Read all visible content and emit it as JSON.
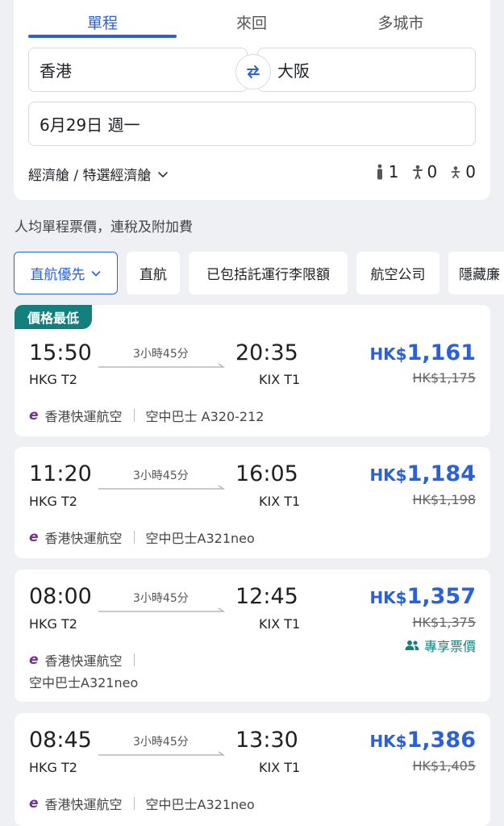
{
  "tabs": [
    {
      "label": "單程",
      "active": true
    },
    {
      "label": "來回",
      "active": false
    },
    {
      "label": "多城市",
      "active": false
    }
  ],
  "search": {
    "origin": "香港",
    "destination": "大阪",
    "date": "6月29日 週一",
    "cabin": "經濟艙 / 特選經濟艙",
    "adults": "1",
    "children": "0",
    "infants": "0"
  },
  "fare_note": "人均單程票價，連稅及附加費",
  "filters": [
    {
      "label": "直航優先",
      "active": true,
      "has_chevron": true
    },
    {
      "label": "直航",
      "active": false
    },
    {
      "label": "已包括託運行李限額",
      "active": false
    },
    {
      "label": "航空公司",
      "active": false
    },
    {
      "label": "隱藏廉",
      "active": false
    }
  ],
  "flights": [
    {
      "badge": "價格最低",
      "dep_time": "15:50",
      "dep_term": "HKG T2",
      "arr_time": "20:35",
      "arr_term": "KIX T1",
      "duration": "3小時45分",
      "currency": "HK$",
      "price": "1,161",
      "old_price": "HK$1,175",
      "airline": "香港快運航空",
      "aircraft": "空中巴士 A320-212"
    },
    {
      "dep_time": "11:20",
      "dep_term": "HKG T2",
      "arr_time": "16:05",
      "arr_term": "KIX T1",
      "duration": "3小時45分",
      "currency": "HK$",
      "price": "1,184",
      "old_price": "HK$1,198",
      "airline": "香港快運航空",
      "aircraft": "空中巴士A321neo"
    },
    {
      "dep_time": "08:00",
      "dep_term": "HKG T2",
      "arr_time": "12:45",
      "arr_term": "KIX T1",
      "duration": "3小時45分",
      "currency": "HK$",
      "price": "1,357",
      "old_price": "HK$1,375",
      "exclusive": "專享票價",
      "airline": "香港快運航空",
      "aircraft": "空中巴士A321neo"
    },
    {
      "dep_time": "08:45",
      "dep_term": "HKG T2",
      "arr_time": "13:30",
      "arr_term": "KIX T1",
      "duration": "3小時45分",
      "currency": "HK$",
      "price": "1,386",
      "old_price": "HK$1,405",
      "airline": "香港快運航空",
      "aircraft": "空中巴士A321neo"
    }
  ],
  "colors": {
    "accent": "#2a61d8",
    "badge": "#14807d",
    "airline_logo": "#7a2c8f"
  }
}
